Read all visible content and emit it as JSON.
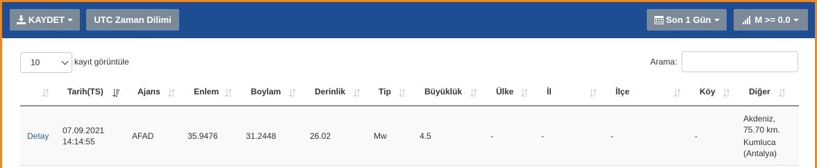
{
  "toolbar": {
    "save_label": "KAYDET",
    "timezone_label": "UTC Zaman Dilimi",
    "period_label": "Son 1 Gün",
    "magnitude_filter_label": "M >= 0.0"
  },
  "length_select": {
    "value": "10"
  },
  "length_suffix": "kayıt görüntüle",
  "search": {
    "label": "Arama:",
    "value": ""
  },
  "table": {
    "columns": [
      "Tarih(TS)",
      "Ajans",
      "Enlem",
      "Boylam",
      "Derinlik",
      "Tip",
      "Büyüklük",
      "Ülke",
      "İl",
      "İlçe",
      "Köy",
      "Diğer"
    ],
    "rows": [
      {
        "detail_link": "Detay",
        "date": "07.09.2021",
        "time": "14:14:55",
        "agency": "AFAD",
        "latitude": "35.9476",
        "longitude": "31.2448",
        "depth": "26.02",
        "type": "Mw",
        "magnitude": "4.5",
        "country": "-",
        "province": "-",
        "district": "-",
        "village": "-",
        "other_lines": [
          "Akdeniz,",
          "75.70 km.",
          "Kumluca",
          "(Antalya)"
        ]
      }
    ]
  },
  "colors": {
    "navbar": "#1e4d94",
    "accent_orange": "#e8892a",
    "button_gray": "#7a8a99",
    "link": "#2a6496"
  }
}
